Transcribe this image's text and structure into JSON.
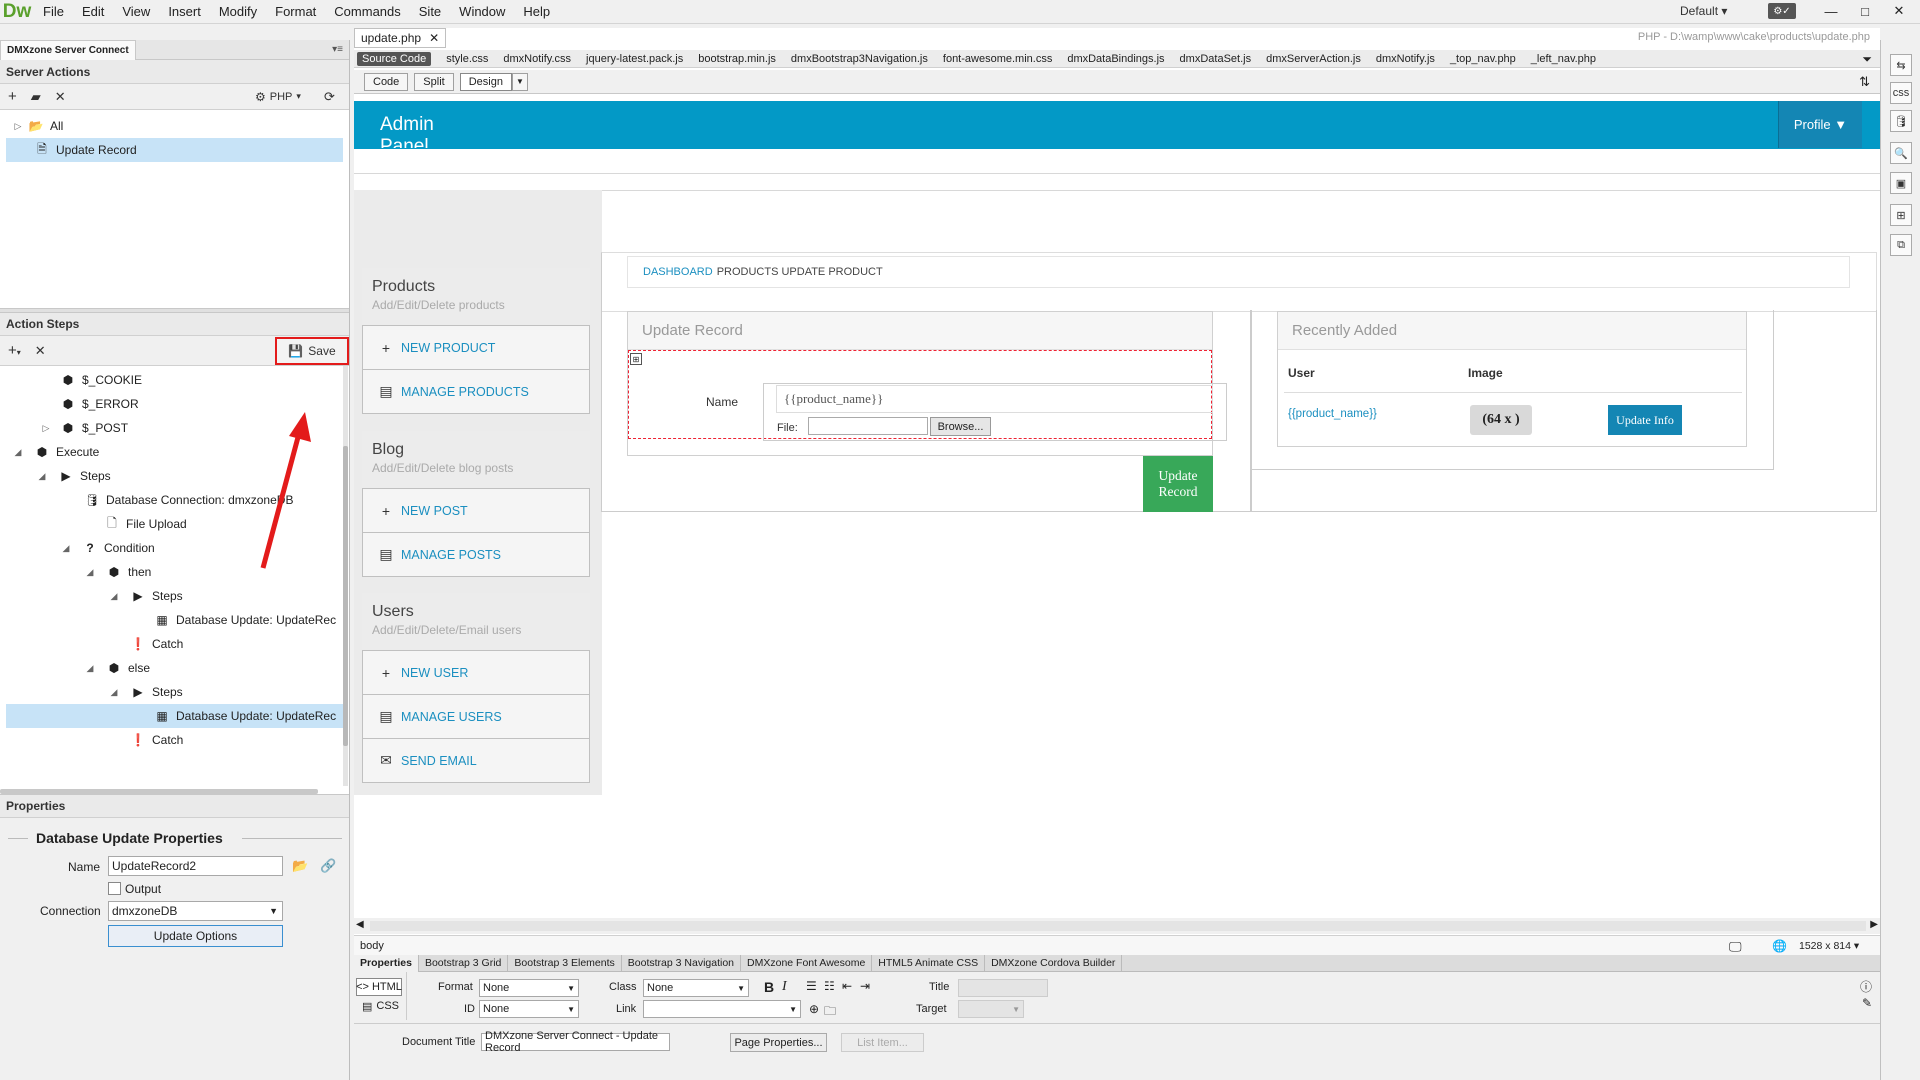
{
  "app": {
    "logo": "Dw"
  },
  "menu": [
    "File",
    "Edit",
    "View",
    "Insert",
    "Modify",
    "Format",
    "Commands",
    "Site",
    "Window",
    "Help"
  ],
  "workspace": "Default",
  "left_panel": {
    "tab": "DMXzone Server Connect",
    "server_actions": {
      "title": "Server Actions",
      "lang": "PHP",
      "items": [
        {
          "label": "All",
          "icon": "folder-icon"
        },
        {
          "label": "Update Record",
          "icon": "page-icon"
        }
      ]
    },
    "action_steps": {
      "title": "Action Steps",
      "save_label": "Save",
      "items": [
        {
          "label": "$_COOKIE",
          "icon": "cube-icon"
        },
        {
          "label": "$_ERROR",
          "icon": "cube-icon"
        },
        {
          "label": "$_POST",
          "icon": "cube-icon"
        },
        {
          "label": "Execute",
          "icon": "cube-icon"
        },
        {
          "label": "Steps",
          "icon": "play-icon"
        },
        {
          "label": "Database Connection: dmxzoneDB",
          "icon": "database-icon"
        },
        {
          "label": "File Upload",
          "icon": "file-icon"
        },
        {
          "label": "Condition",
          "icon": "question-icon"
        },
        {
          "label": "then",
          "icon": "cube-icon"
        },
        {
          "label": "Steps",
          "icon": "play-icon"
        },
        {
          "label": "Database Update: UpdateRec",
          "icon": "table-icon"
        },
        {
          "label": "Catch",
          "icon": "alert-icon"
        },
        {
          "label": "else",
          "icon": "cube-icon"
        },
        {
          "label": "Steps",
          "icon": "play-icon"
        },
        {
          "label": "Database Update: UpdateRec",
          "icon": "table-icon"
        },
        {
          "label": "Catch",
          "icon": "alert-icon"
        }
      ]
    },
    "properties": {
      "title": "Properties",
      "subtitle": "Database Update Properties",
      "name_label": "Name",
      "name_value": "UpdateRecord2",
      "output_label": "Output",
      "connection_label": "Connection",
      "connection_value": "dmxzoneDB",
      "update_options": "Update Options"
    }
  },
  "document": {
    "tab": "update.php",
    "path": "PHP - D:\\wamp\\www\\cake\\products\\update.php",
    "related_files": [
      "Source Code",
      "style.css",
      "dmxNotify.css",
      "jquery-latest.pack.js",
      "bootstrap.min.js",
      "dmxBootstrap3Navigation.js",
      "font-awesome.min.css",
      "dmxDataBindings.js",
      "dmxDataSet.js",
      "dmxServerAction.js",
      "dmxNotify.js",
      "_top_nav.php",
      "_left_nav.php"
    ],
    "views": [
      "Code",
      "Split",
      "Design"
    ]
  },
  "page": {
    "header_title": "Admin Panel",
    "profile": "Profile",
    "breadcrumb_link": "DASHBOARD",
    "breadcrumb_rest": "PRODUCTS UPDATE PRODUCT",
    "nav": [
      {
        "title": "Products",
        "sub": "Add/Edit/Delete products",
        "links": [
          "NEW PRODUCT",
          "MANAGE PRODUCTS"
        ]
      },
      {
        "title": "Blog",
        "sub": "Add/Edit/Delete blog posts",
        "links": [
          "NEW POST",
          "MANAGE POSTS"
        ]
      },
      {
        "title": "Users",
        "sub": "Add/Edit/Delete/Email users",
        "links": [
          "NEW USER",
          "MANAGE USERS",
          "SEND EMAIL"
        ]
      }
    ],
    "update_panel": {
      "title": "Update Record",
      "name_label": "Name",
      "name_value": "{{product_name}}",
      "file_label": "File:",
      "browse": "Browse...",
      "submit": "Update Record"
    },
    "recent_panel": {
      "title": "Recently Added",
      "col_user": "User",
      "col_image": "Image",
      "cell_user": "{{product_name}}",
      "cell_image": "(64 x )",
      "cell_button": "Update Info"
    }
  },
  "status": {
    "tag": "body",
    "size": "1528 x 814"
  },
  "property_tabs": [
    "Properties",
    "Bootstrap 3 Grid",
    "Bootstrap 3 Elements",
    "Bootstrap 3 Navigation",
    "DMXzone Font Awesome",
    "HTML5 Animate CSS",
    "DMXzone Cordova Builder"
  ],
  "property_inspector": {
    "html": "HTML",
    "css": "CSS",
    "format_label": "Format",
    "format_value": "None",
    "class_label": "Class",
    "class_value": "None",
    "id_label": "ID",
    "id_value": "None",
    "link_label": "Link",
    "title_label": "Title",
    "target_label": "Target",
    "doc_title_label": "Document Title",
    "doc_title_value": "DMXzone Server Connect - Update Record",
    "page_properties": "Page Properties...",
    "list_item": "List Item..."
  },
  "colors": {
    "header": "#0399c6",
    "profile": "#1486b4",
    "submit": "#38a859",
    "link": "#1b8fc0",
    "annotation": "#e31b1b",
    "update_info": "#1486b4"
  }
}
